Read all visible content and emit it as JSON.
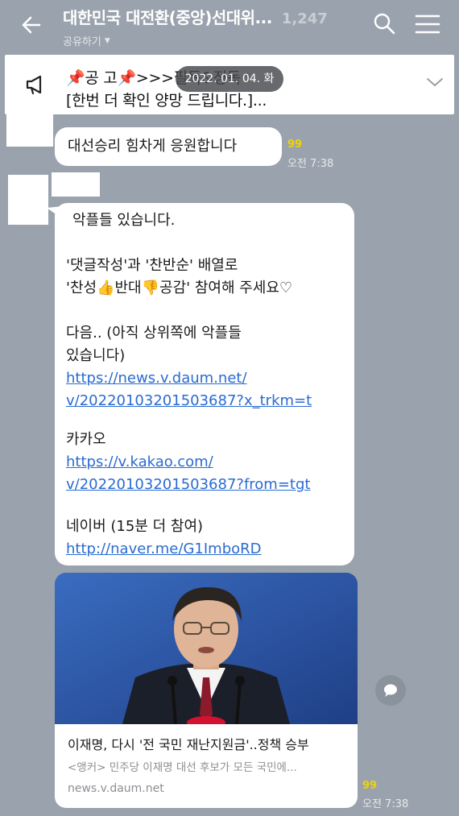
{
  "header": {
    "title": "대한민국 대전환(중앙)선대위...",
    "member_count": "1,247",
    "share_label": "공유하기",
    "icons": [
      "back-arrow-icon",
      "search-icon",
      "menu-icon",
      "chevron-down-icon"
    ]
  },
  "notice": {
    "line1": "공       고",
    "line1_suffix": ">>>필독&정독",
    "line2": "[한번 더 확인 양망 드립니다.]...",
    "date_chip": "2022. 01. 04. 화",
    "icon": "megaphone-icon"
  },
  "messages": [
    {
      "text": "대선승리 힘차게 응원합니다",
      "read_count": "99",
      "time": "오전 7:38"
    },
    {
      "intro": "악플들 있습니다.",
      "line_a": "'댓글작성'과 '찬반순' 배열로",
      "line_b_1": "'찬성",
      "line_b_2": "반대",
      "line_b_3": "공감' 참여해 주세요♡",
      "line_c": "다음.. (아직 상위쪽에 악플들",
      "line_d": "있습니다)",
      "link1_a": "https://news.v.daum.net/",
      "link1_b": "v/20220103201503687?x_trkm=t",
      "kakao_label": "카카오",
      "link2_a": "https://v.kakao.com/",
      "link2_b": "v/20220103201503687?from=tgt",
      "naver_label": "네이버 (15분 더 참여)",
      "link3": "http://naver.me/G1ImboRD"
    }
  ],
  "preview": {
    "title": "이재명, 다시 '전 국민 재난지원금'..정책 승부",
    "desc": "<앵커> 민주당 이재명 대선 후보가 모든 국민에...",
    "domain": "news.v.daum.net",
    "read_count": "99",
    "time": "오전 7:38"
  },
  "colors": {
    "background": "#9aa3ad",
    "read_count": "#f2d200",
    "link": "#2a6bd1"
  }
}
